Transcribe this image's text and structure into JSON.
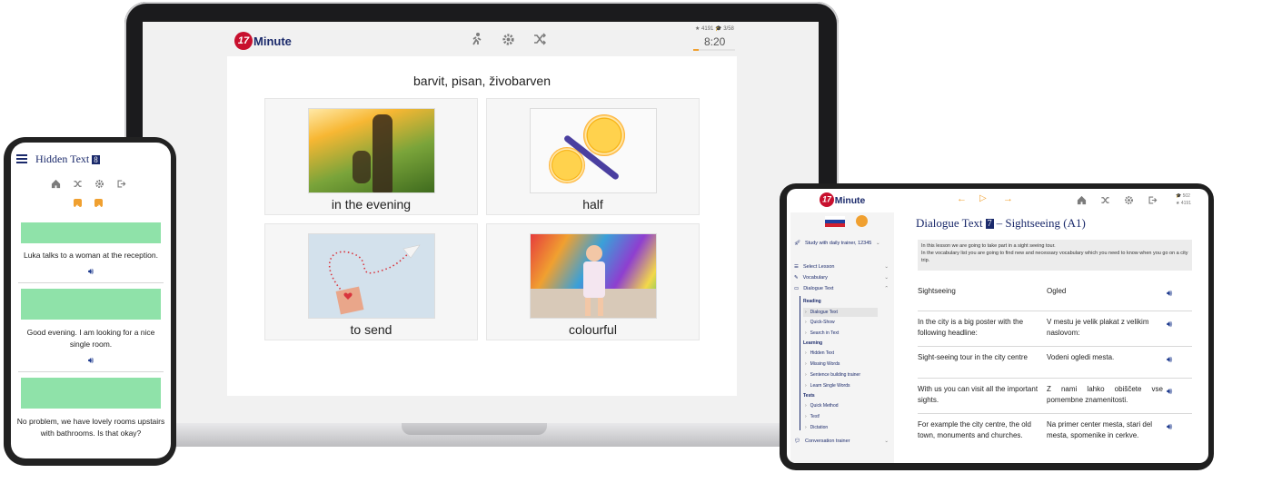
{
  "colors": {
    "brand_red": "#c8102e",
    "brand_navy": "#1b2a6b",
    "accent_orange": "#f0a030",
    "green_block": "#8fe2a9"
  },
  "laptop": {
    "logo_badge": "17",
    "logo_word": "Minute",
    "stats": "★ 4191 🎓 3/58",
    "timer": "8:20",
    "prompt": "barvit, pisan, živobarven",
    "cards": [
      {
        "label": "in the evening",
        "image": "silhouette-with-dog-in-meadow"
      },
      {
        "label": "half",
        "image": "halved-orange-and-knife"
      },
      {
        "label": "to send",
        "image": "paper-plane-with-hearts"
      },
      {
        "label": "colourful",
        "image": "girl-in-front-of-paint-wall"
      }
    ]
  },
  "phone": {
    "title": "Hidden Text",
    "title_badge": "8",
    "lines": [
      "Luka talks to a woman at the reception.",
      "Good evening. I am looking for a nice single room.",
      "No problem, we have lovely rooms upstairs with bathrooms. Is that okay?"
    ]
  },
  "tablet": {
    "logo_badge": "17",
    "logo_word": "Minute",
    "stats_top": "🎓 502",
    "stats_bottom": "★ 4191",
    "sidebar": {
      "study": "Study with daily trainer, 12345",
      "select_lesson": "Select Lesson",
      "vocabulary": "Vocabulary",
      "dialogue_text": "Dialogue Text",
      "group_reading": "Reading",
      "reading_items": [
        "Dialogue Text",
        "Quick-Show",
        "Search in Text"
      ],
      "group_learning": "Learning",
      "learning_items": [
        "Hidden Text",
        "Missing Words",
        "Sentence building trainer",
        "Learn Single Words"
      ],
      "group_tests": "Tests",
      "test_items": [
        "Quick Method",
        "Test!",
        "Dictation"
      ],
      "conversation": "Conversation trainer"
    },
    "heading": "Dialogue Text",
    "heading_badge": "7",
    "heading_rest": "– Sightseeing (A1)",
    "intro_line1": "In this lesson we are going to take part in a sight seeing tour.",
    "intro_line2": "In the vocabulary list you are going to find new and necessary vocabulary which you need to know when you go on a city trip.",
    "rows": [
      {
        "en": "Sightseeing",
        "sl": "Ogled"
      },
      {
        "en": "In the city is a big poster with the following headline:",
        "sl": "V mestu je velik plakat z velikim naslovom:"
      },
      {
        "en": "Sight-seeing tour in the city centre",
        "sl": "Vodeni ogledi mesta."
      },
      {
        "en": "With us you can visit all the important sights.",
        "sl": "Z nami lahko obiščete vse pomembne znamenitosti."
      },
      {
        "en": "For example the city centre, the old town, monuments and churches.",
        "sl": "Na primer center mesta, stari del mesta, spomenike in cerkve."
      }
    ]
  }
}
